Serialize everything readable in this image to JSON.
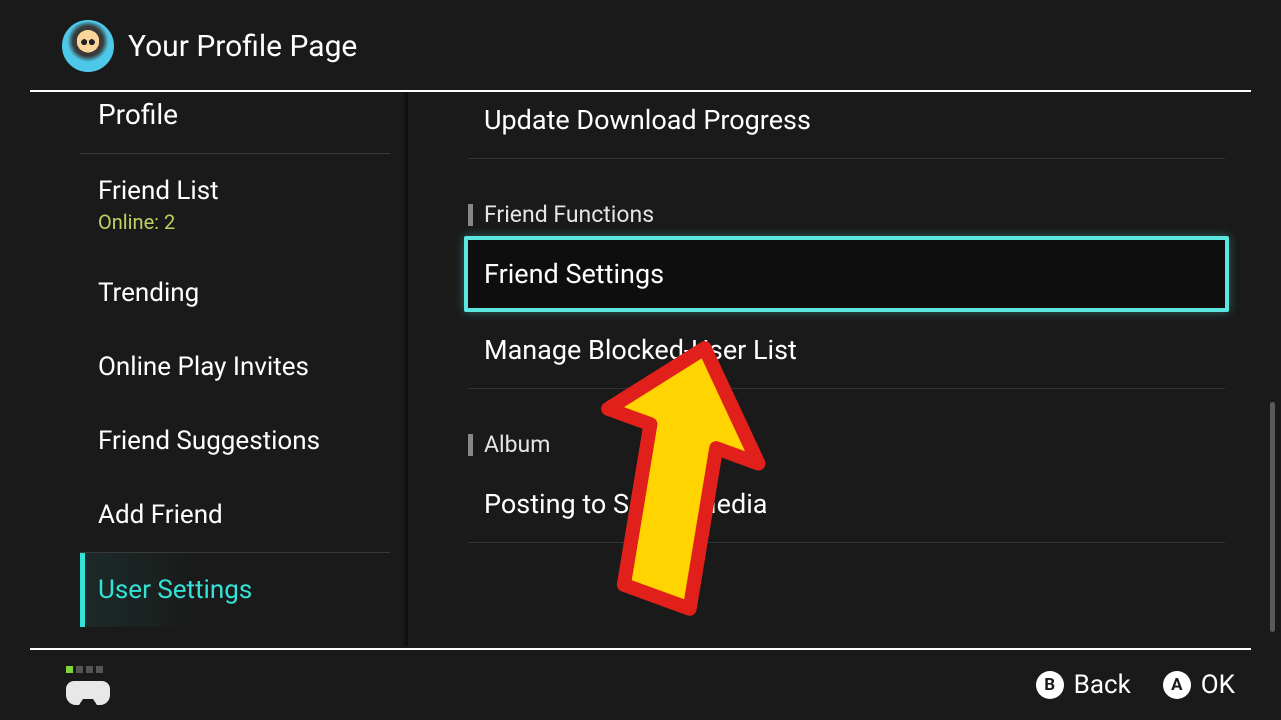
{
  "header": {
    "title": "Your Profile Page"
  },
  "sidebar": {
    "items": [
      {
        "label": "Profile"
      },
      {
        "label": "Friend List",
        "sub": "Online: 2"
      },
      {
        "label": "Trending"
      },
      {
        "label": "Online Play Invites"
      },
      {
        "label": "Friend Suggestions"
      },
      {
        "label": "Add Friend"
      },
      {
        "label": "User Settings",
        "active": true
      }
    ]
  },
  "content": {
    "top_item": "Update Download Progress",
    "sections": [
      {
        "heading": "Friend Functions",
        "items": [
          {
            "label": "Friend Settings",
            "highlighted": true
          },
          {
            "label": "Manage Blocked-User List"
          }
        ]
      },
      {
        "heading": "Album",
        "items": [
          {
            "label": "Posting to Social Media"
          }
        ]
      }
    ]
  },
  "footer": {
    "back_letter": "B",
    "back_label": "Back",
    "ok_letter": "A",
    "ok_label": "OK"
  }
}
